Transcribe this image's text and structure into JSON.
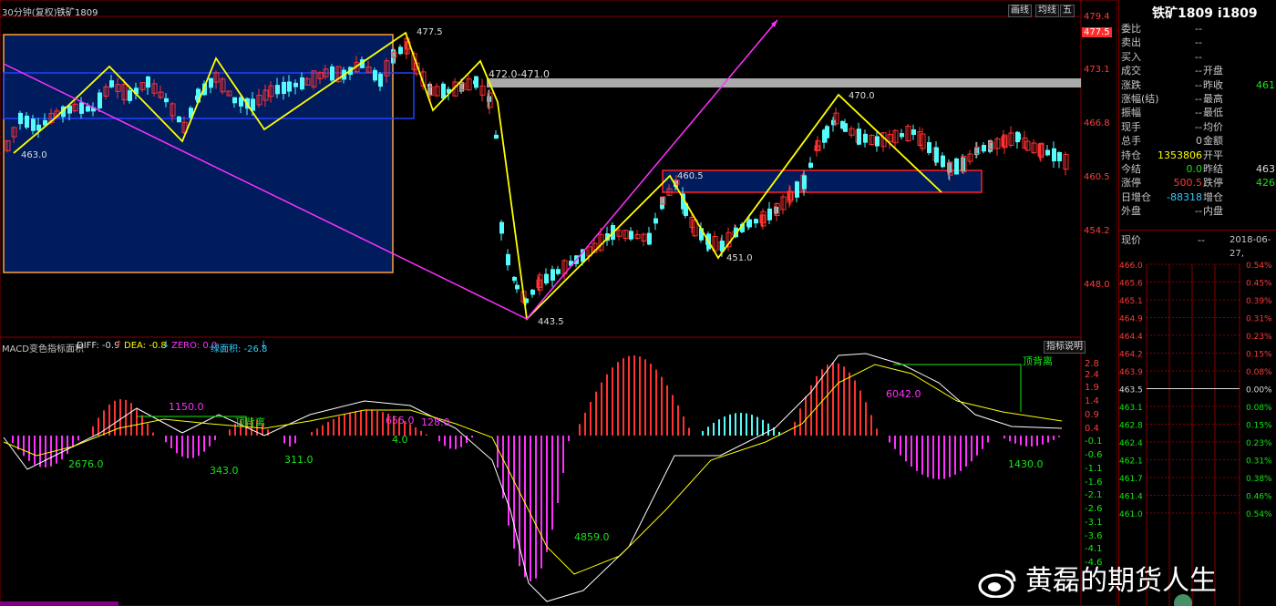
{
  "header": {
    "period_label": "30分钟(复权)",
    "symbol_label": "铁矿1809",
    "buttons": [
      "画线",
      "均线",
      "五"
    ]
  },
  "price_axis": {
    "ticks": [
      "479.4",
      "477.5",
      "473.1",
      "466.8",
      "460.5",
      "454.2",
      "448.0"
    ],
    "current_tag": "477.5"
  },
  "annotations": {
    "low_463": "463.0",
    "high_4775": "477.5",
    "range_472": "472.0-471.0",
    "high_470": "470.0",
    "mid_4605": "460.5",
    "low_451": "451.0",
    "low_4435": "443.5"
  },
  "macd": {
    "title": "MACD变色指标面积",
    "diff": "DIFF: -0.9",
    "dea": "DEA: -0.8",
    "zero": "ZERO: 0.0",
    "green_area": "绿面积: -26.8",
    "help_button": "指标说明",
    "axis_ticks": [
      "2.8",
      "2.4",
      "1.9",
      "1.4",
      "0.9",
      "0.4",
      "-0.1",
      "-0.6",
      "-1.1",
      "-1.6",
      "-2.1",
      "-2.6",
      "-3.1",
      "-3.6",
      "-4.1",
      "-4.6"
    ],
    "labels": {
      "a2676": "2676.0",
      "a1150": "1150.0",
      "top_div1": "顶背离",
      "a343": "343.0",
      "a311": "311.0",
      "a655": "655.0",
      "a128": "128.0",
      "a4": "4.0",
      "a4859": "4859.0",
      "a6042": "6042.0",
      "top_div2": "顶背离",
      "a1430": "1430.0"
    }
  },
  "quote_panel": {
    "title": "铁矿1809 i1809",
    "rows": [
      {
        "l": "委比",
        "v": "--",
        "l2": "",
        "v2": ""
      },
      {
        "l": "卖出",
        "v": "--",
        "l2": "",
        "v2": ""
      },
      {
        "l": "买入",
        "v": "--",
        "l2": "",
        "v2": ""
      },
      {
        "l": "成交",
        "v": "--",
        "l2": "开盘",
        "v2": ""
      },
      {
        "l": "涨跌",
        "v": "--",
        "l2": "昨收",
        "v2": "461"
      },
      {
        "l": "涨幅(结)",
        "v": "--",
        "l2": "最高",
        "v2": ""
      },
      {
        "l": "振幅",
        "v": "--",
        "l2": "最低",
        "v2": ""
      },
      {
        "l": "现手",
        "v": "--",
        "l2": "均价",
        "v2": ""
      },
      {
        "l": "总手",
        "v": "0",
        "l2": "金额",
        "v2": ""
      },
      {
        "l": "持仓",
        "v": "1353806",
        "l2": "开平",
        "v2": ""
      },
      {
        "l": "今结",
        "v": "0.0",
        "l2": "昨结",
        "v2": "463"
      },
      {
        "l": "涨停",
        "v": "500.5",
        "l2": "跌停",
        "v2": "426"
      },
      {
        "l": "日增仓",
        "v": "-88318",
        "l2": "增仓",
        "v2": ""
      },
      {
        "l": "外盘",
        "v": "--",
        "l2": "内盘",
        "v2": ""
      }
    ],
    "tick_header": {
      "label": "现价",
      "value": "--",
      "date": "2018-06-27,"
    },
    "depth_left": [
      "466.0",
      "465.6",
      "465.1",
      "464.9",
      "464.4",
      "464.2",
      "463.9",
      "463.5",
      "463.1",
      "462.8",
      "462.4",
      "462.1",
      "461.7",
      "461.4",
      "461.0"
    ],
    "depth_right": [
      "0.54%",
      "0.45%",
      "0.39%",
      "0.31%",
      "0.23%",
      "0.15%",
      "0.08%",
      "0.00%",
      "0.08%",
      "0.15%",
      "0.23%",
      "0.31%",
      "0.38%",
      "0.46%",
      "0.54%"
    ]
  },
  "watermark": "黄磊的期货人生",
  "colors": {
    "up": "#ff3232",
    "down": "#54fcfc",
    "box": "#001c5c",
    "yellow": "#ffff00",
    "magenta": "#ff30ff"
  }
}
